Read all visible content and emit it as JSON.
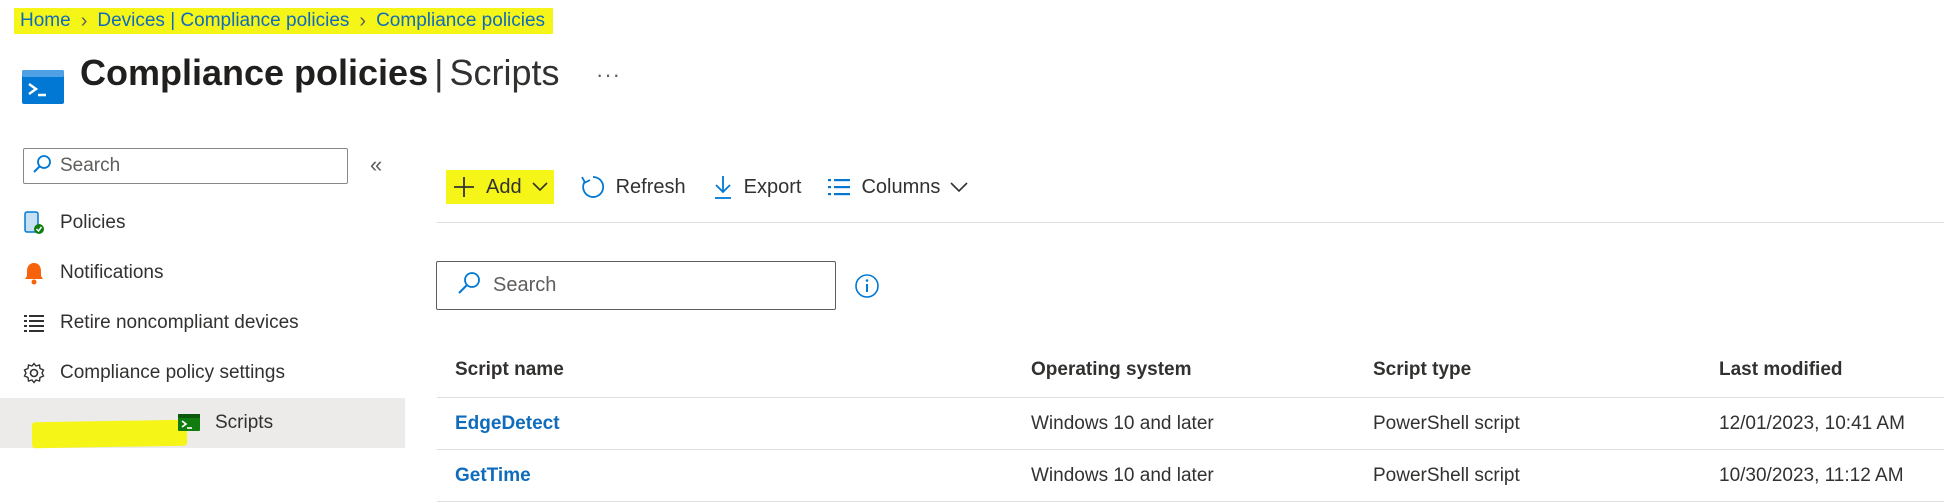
{
  "breadcrumb": {
    "items": [
      "Home",
      "Devices | Compliance policies",
      "Compliance policies"
    ]
  },
  "header": {
    "title_main": "Compliance policies",
    "title_separator": "|",
    "title_sub": "Scripts",
    "more_label": "···",
    "icon": "script-blade-icon"
  },
  "sidebar": {
    "search_placeholder": "Search",
    "collapse_label": "«",
    "items": [
      {
        "label": "Policies",
        "icon": "policies-icon"
      },
      {
        "label": "Notifications",
        "icon": "bell-icon"
      },
      {
        "label": "Retire noncompliant devices",
        "icon": "list-icon"
      },
      {
        "label": "Compliance policy settings",
        "icon": "gear-icon"
      },
      {
        "label": "Scripts",
        "icon": "script-icon",
        "active": true
      }
    ]
  },
  "toolbar": {
    "add_label": "Add",
    "refresh_label": "Refresh",
    "export_label": "Export",
    "columns_label": "Columns"
  },
  "main": {
    "search_placeholder": "Search"
  },
  "table": {
    "columns": [
      "Script name",
      "Operating system",
      "Script type",
      "Last modified"
    ],
    "rows": [
      {
        "name": "EdgeDetect",
        "os": "Windows 10 and later",
        "type": "PowerShell script",
        "modified": "12/01/2023, 10:41 AM"
      },
      {
        "name": "GetTime",
        "os": "Windows 10 and later",
        "type": "PowerShell script",
        "modified": "10/30/2023, 11:12 AM"
      }
    ]
  },
  "colors": {
    "link": "#0f6cbd",
    "highlight": "#f5f518",
    "active_nav": "#edebe9",
    "accent": "#0078d4"
  }
}
